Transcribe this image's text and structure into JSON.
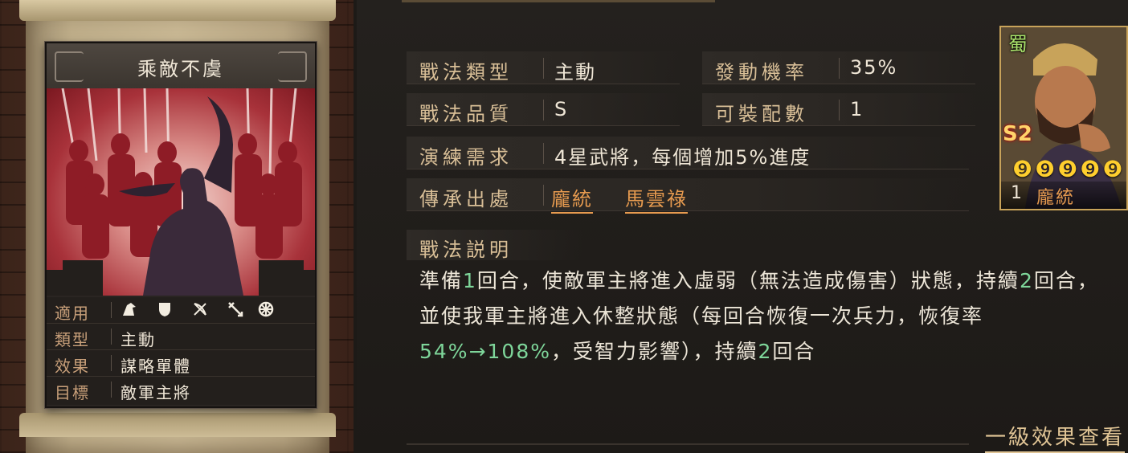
{
  "skill": {
    "name": "乘敵不虞",
    "stats": [
      {
        "label": "適用",
        "value": ""
      },
      {
        "label": "類型",
        "value": "主動"
      },
      {
        "label": "效果",
        "value": "謀略單體"
      },
      {
        "label": "目標",
        "value": "敵軍主將"
      }
    ],
    "unit_icons": [
      "cavalry-icon",
      "shield-icon",
      "bow-icon",
      "spear-icon",
      "chariot-icon"
    ]
  },
  "info": {
    "type_label": "戰法類型",
    "type_value": "主動",
    "chance_label": "發動機率",
    "chance_value": "35%",
    "quality_label": "戰法品質",
    "quality_value": "S",
    "slots_label": "可裝配數",
    "slots_value": "1",
    "req_label": "演練需求",
    "req_value": "4星武將，每個增加5%進度",
    "source_label": "傳承出處",
    "source_values": [
      "龐統",
      "馬雲祿"
    ]
  },
  "description": {
    "header": "戰法説明",
    "parts": [
      {
        "t": "準備",
        "hl": false
      },
      {
        "t": "1",
        "hl": true
      },
      {
        "t": "回合，使敵軍主將進入虛弱（無法造成傷害）狀態，持續",
        "hl": false
      },
      {
        "t": "2",
        "hl": true
      },
      {
        "t": "回合，並使我軍主將進入休整狀態（每回合恢復一次兵力，恢復率",
        "hl": false
      },
      {
        "t": "54%→108%",
        "hl": true
      },
      {
        "t": "，受智力影響），持續",
        "hl": false
      },
      {
        "t": "2",
        "hl": true
      },
      {
        "t": "回合",
        "hl": false
      }
    ]
  },
  "level_link": "一級效果查看",
  "general": {
    "kingdom": "蜀",
    "rank": "S2",
    "stars": "❾❾❾❾❾",
    "cost": "1",
    "name": "龐統"
  },
  "colors": {
    "label": "#d9bf97",
    "highlight": "#7ed69a",
    "orange": "#e69a4f",
    "card_red": "#a8323a"
  }
}
